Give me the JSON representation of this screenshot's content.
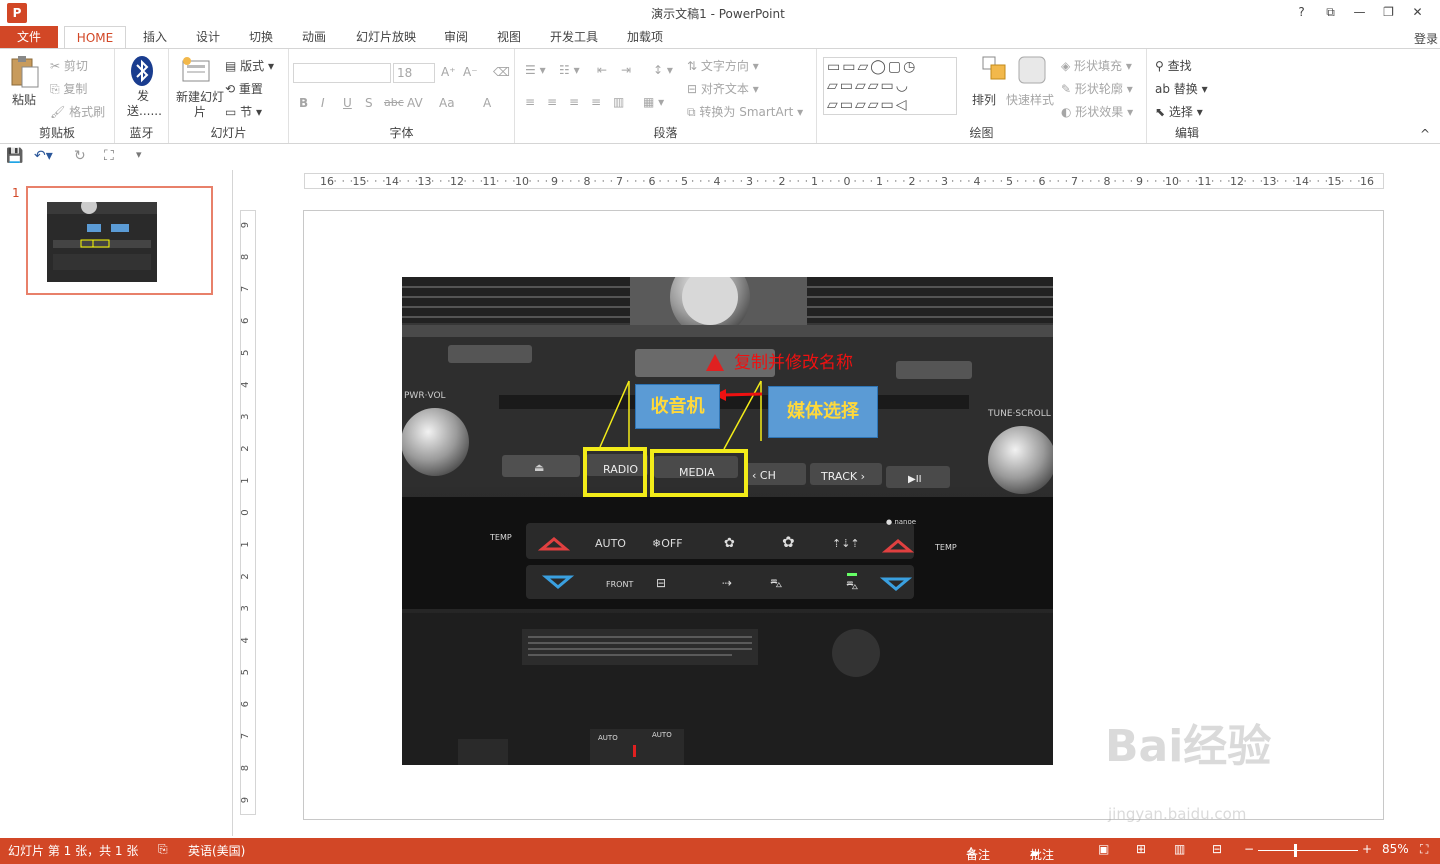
{
  "window": {
    "title": "演示文稿1 - PowerPoint",
    "app_icon": "P",
    "help": "?",
    "ribbon_display": "⧉",
    "minimize": "—",
    "restore": "❐",
    "close": "✕"
  },
  "tabs": {
    "file": "文件",
    "items": [
      "HOME",
      "插入",
      "设计",
      "切换",
      "动画",
      "幻灯片放映",
      "审阅",
      "视图",
      "开发工具",
      "加载项"
    ],
    "login": "登录"
  },
  "ribbon": {
    "clipboard": {
      "paste": "粘贴",
      "cut": "剪切",
      "copy": "复制",
      "format_painter": "格式刷",
      "label": "剪贴板"
    },
    "bluetooth": {
      "send": "发送......",
      "label": "蓝牙"
    },
    "slides": {
      "new_slide": "新建幻灯片",
      "layout": "版式",
      "reset": "重置",
      "section": "节",
      "label": "幻灯片"
    },
    "font": {
      "size": "18",
      "label": "字体",
      "bold": "B",
      "italic": "I",
      "underline": "U",
      "shadow": "S",
      "strike": "abc",
      "spacing": "AV",
      "case": "Aa",
      "color": "A",
      "grow": "A⁺",
      "shrink": "A⁻"
    },
    "paragraph": {
      "text_direction": "文字方向",
      "align_text": "对齐文本",
      "smartart": "转换为 SmartArt",
      "label": "段落"
    },
    "drawing": {
      "arrange": "排列",
      "quick_styles": "快速样式",
      "shape_fill": "形状填充",
      "shape_outline": "形状轮廓",
      "shape_effects": "形状效果",
      "label": "绘图"
    },
    "editing": {
      "find": "查找",
      "replace": "替换",
      "select": "选择",
      "label": "编辑"
    }
  },
  "ruler": {
    "h_ticks": [
      "16",
      "15",
      "14",
      "13",
      "12",
      "11",
      "10",
      "9",
      "8",
      "7",
      "6",
      "5",
      "4",
      "3",
      "2",
      "1",
      "0",
      "1",
      "2",
      "3",
      "4",
      "5",
      "6",
      "7",
      "8",
      "9",
      "10",
      "11",
      "12",
      "13",
      "14",
      "15",
      "16"
    ],
    "v_ticks": [
      "9",
      "8",
      "7",
      "6",
      "5",
      "4",
      "3",
      "2",
      "1",
      "0",
      "1",
      "2",
      "3",
      "4",
      "5",
      "6",
      "7",
      "8",
      "9"
    ]
  },
  "slide_panel": {
    "slide_number": "1"
  },
  "slide": {
    "callout_radio": "收音机",
    "callout_media": "媒体选择",
    "annotation": "复制并修改名称",
    "photo_labels": {
      "pwr_vol": "PWR·VOL",
      "tune_scroll": "TUNE·SCROLL",
      "radio": "RADIO",
      "media": "MEDIA",
      "ch": "‹ CH",
      "track": "TRACK ›",
      "play": "▶II",
      "temp_left": "TEMP",
      "temp_right": "TEMP",
      "auto": "AUTO",
      "off": "❄OFF",
      "front": "FRONT",
      "nanoe": "● nanoe",
      "auto_seat1": "AUTO",
      "auto_seat2": "AUTO"
    }
  },
  "statusbar": {
    "slide_info": "幻灯片 第 1 张，共 1 张",
    "language": "英语(美国)",
    "notes": "备注",
    "comments": "批注",
    "zoom": "85%"
  },
  "watermark": {
    "main": "Bai经验",
    "sub": "jingyan.baidu.com"
  },
  "colors": {
    "accent": "#d24726",
    "callout": "#5b9bd5",
    "callout_text": "#ffd93b",
    "highlight": "#f3ec19",
    "annotation": "#e11111"
  }
}
